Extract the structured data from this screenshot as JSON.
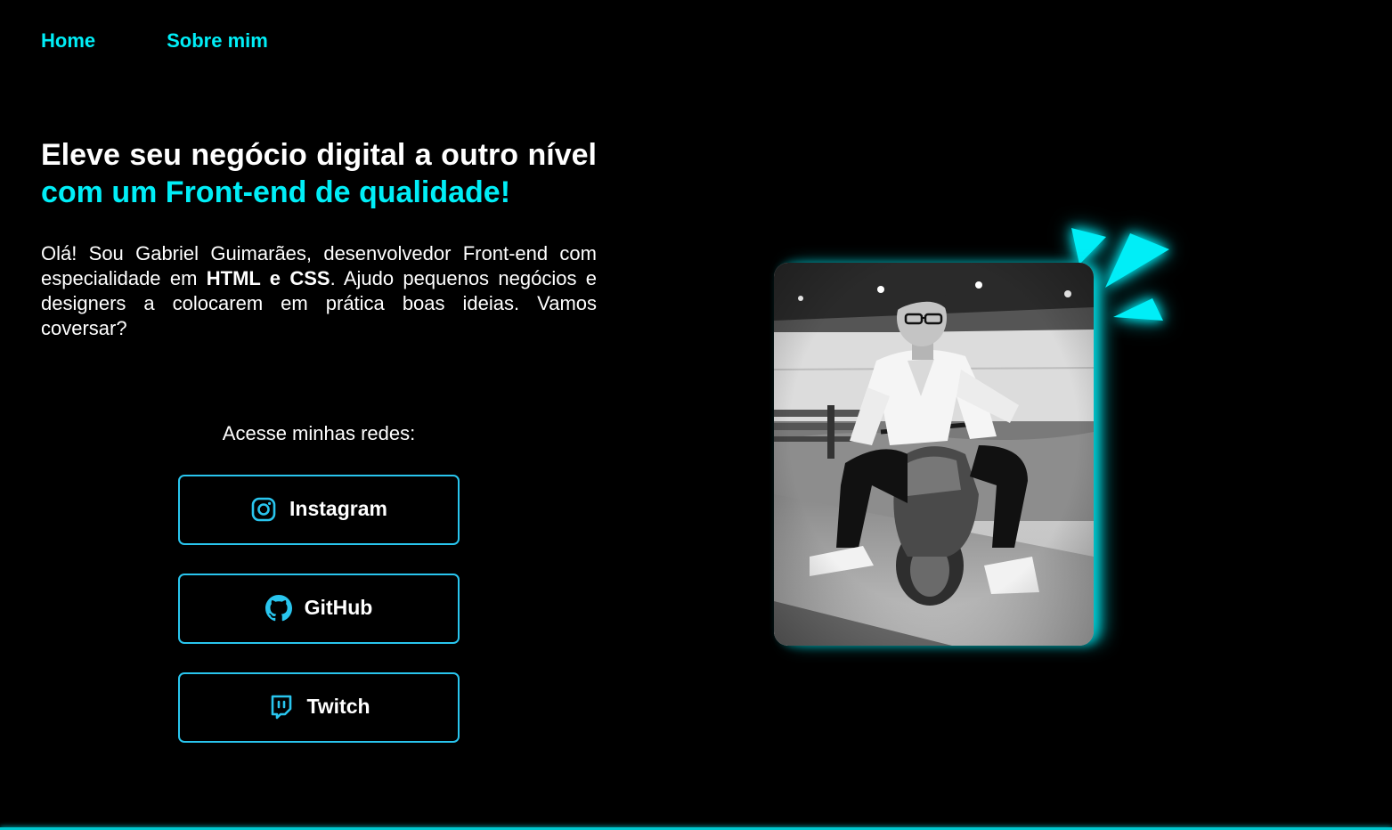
{
  "nav": {
    "home": "Home",
    "about": "Sobre mim"
  },
  "hero": {
    "title_part1": "Eleve seu negócio digital a outro nível ",
    "title_part2": "com um Front-end de qualidade!",
    "intro_part1": "Olá! Sou Gabriel Guimarães, desenvolvedor Front-end com especialidade em ",
    "intro_bold": "HTML e CSS",
    "intro_part2": ". Ajudo pequenos negócios e designers a colocarem em prática boas ideias. Vamos coversar?"
  },
  "social": {
    "title": "Acesse minhas redes:",
    "instagram": "Instagram",
    "github": "GitHub",
    "twitch": "Twitch"
  },
  "colors": {
    "background": "#000000",
    "accent": "#00eef7",
    "button_border": "#29c5ee",
    "text": "#ffffff"
  },
  "icons": {
    "instagram": "instagram-icon",
    "github": "github-icon",
    "twitch": "twitch-icon"
  }
}
